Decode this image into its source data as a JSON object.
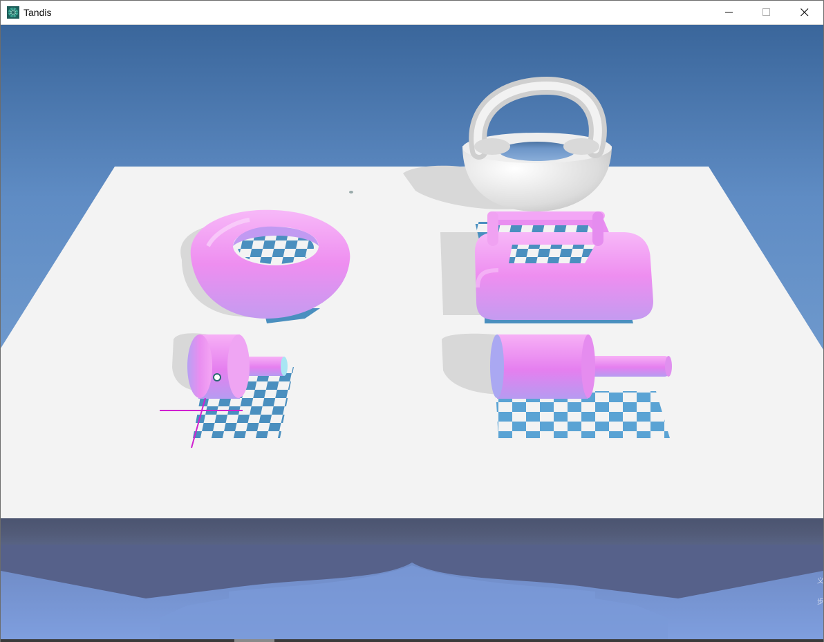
{
  "window": {
    "title": "Tandis",
    "controls": {
      "minimize": "minimize",
      "maximize": "maximize",
      "close": "close"
    }
  },
  "viewport": {
    "scene": "3D scene",
    "colors": {
      "sky_top": "#3d6aa0",
      "sky_bottom": "#7aa5d8",
      "table": "#f3f3f3",
      "pink": "#f094f0",
      "pink_light": "#f7c6fa",
      "lilac": "#b3a2f5",
      "checker": "#4a8fbf",
      "axis": "#d020d0",
      "white_model": "#e9e9e9"
    },
    "objects": [
      {
        "name": "pink-torus-bowl",
        "color": "pink"
      },
      {
        "name": "white-basket-handle",
        "color": "white"
      },
      {
        "name": "pink-rounded-frame",
        "color": "pink"
      },
      {
        "name": "pink-cylinder-small",
        "color": "pink"
      },
      {
        "name": "pink-cylinder-large",
        "color": "pink"
      }
    ]
  }
}
